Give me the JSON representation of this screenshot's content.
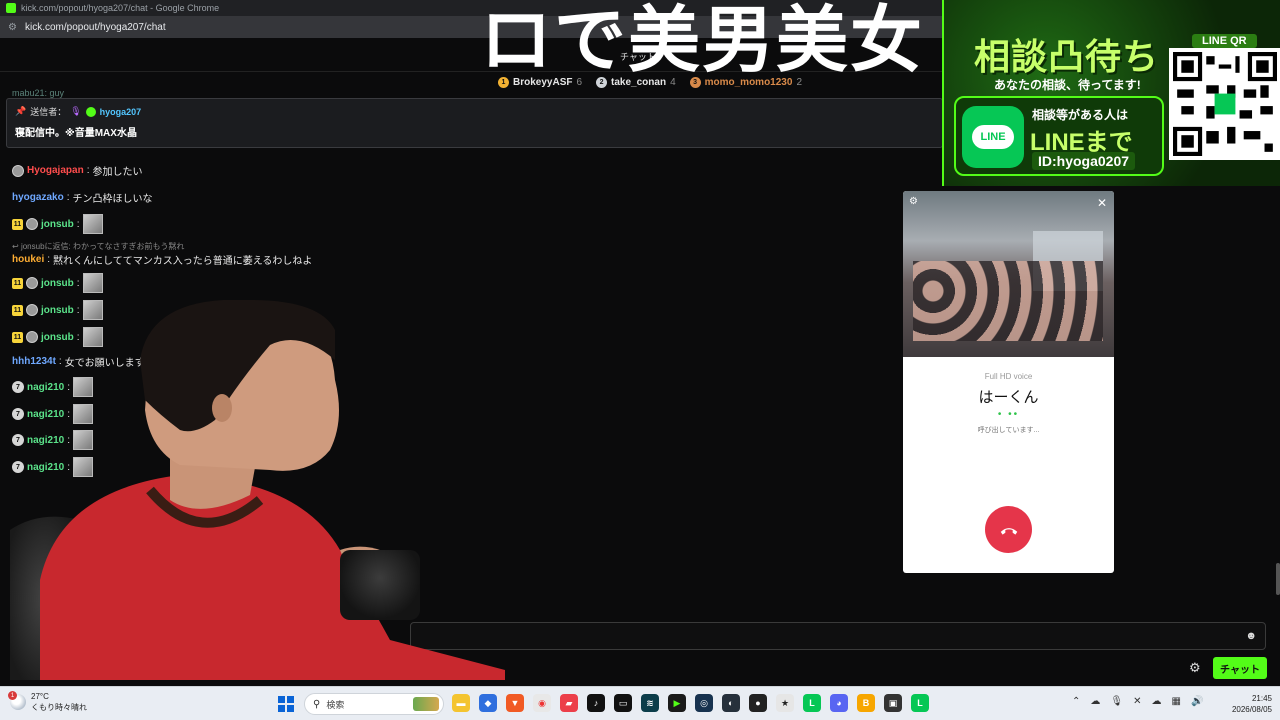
{
  "browser": {
    "window_title": "kick.com/popout/hyoga207/chat - Google Chrome",
    "url": "kick.com/popout/hyoga207/chat"
  },
  "chat": {
    "header_title": "チャット",
    "overlay_title": "ロで美男美女",
    "top_gifters": [
      {
        "rank": "1",
        "name": "BrokeyyASF",
        "count": "6",
        "color": "#f2b233"
      },
      {
        "rank": "2",
        "name": "take_conan",
        "count": "4",
        "color": "#cfd3d8"
      },
      {
        "rank": "3",
        "name": "momo_momo1230",
        "count": "2",
        "color": "#d98a4a"
      }
    ],
    "cut_line": "mabu21: guy",
    "pinned": {
      "label": "送信者：",
      "user": "hyoga207",
      "text": "寝配信中。※音量MAX水晶"
    },
    "messages": [
      {
        "user": "Hyogajapan",
        "color": "#ff4d4d",
        "text": "参加したい"
      },
      {
        "user": "hyogazako",
        "color": "#6fa8ff",
        "text": "チン凸枠ほしいな"
      },
      {
        "user": "jonsub",
        "color": "#5be38a",
        "sub": "11"
      },
      {
        "reply": "jonsubに返信: わかってなさすぎお前もう黙れ"
      },
      {
        "user": "houkei",
        "color": "#ffae33",
        "text": "黙れくんにしててマンカス入ったら普通に萎えるわしねよ"
      },
      {
        "user": "jonsub",
        "color": "#5be38a",
        "sub": "11"
      },
      {
        "user": "jonsub",
        "color": "#5be38a",
        "sub": "11"
      },
      {
        "user": "jonsub",
        "color": "#5be38a",
        "sub": "11"
      },
      {
        "user": "hhh1234t",
        "color": "#6fa8ff",
        "text": "女でお願いします"
      },
      {
        "user": "nagi210",
        "color": "#5be38a",
        "rank": "7"
      },
      {
        "user": "nagi210",
        "color": "#5be38a",
        "rank": "7"
      },
      {
        "user": "nagi210",
        "color": "#5be38a",
        "rank": "7"
      },
      {
        "user": "nagi210",
        "color": "#5be38a",
        "rank": "7"
      }
    ],
    "input_placeholder": "",
    "send_label": "チャット"
  },
  "banner": {
    "title": "相談凸待ち",
    "subtitle": "あなたの相談、待ってます!",
    "qr_label": "LINE QR",
    "line_logo": "LINE",
    "line_text1": "相談等がある人は",
    "line_text2": "LINEまで",
    "line_id": "ID:hyoga0207"
  },
  "call": {
    "quality": "Full HD voice",
    "name": "はーくん",
    "status": "呼び出しています..."
  },
  "taskbar": {
    "weather_badge": "1",
    "temp": "27°C",
    "weather": "くもり時々晴れ",
    "search": "検索",
    "time": "21:45",
    "date": "2026/08/05"
  },
  "colors": {
    "kick_green": "#53fc18",
    "line_green": "#06c755",
    "hangup_red": "#e5354a"
  }
}
